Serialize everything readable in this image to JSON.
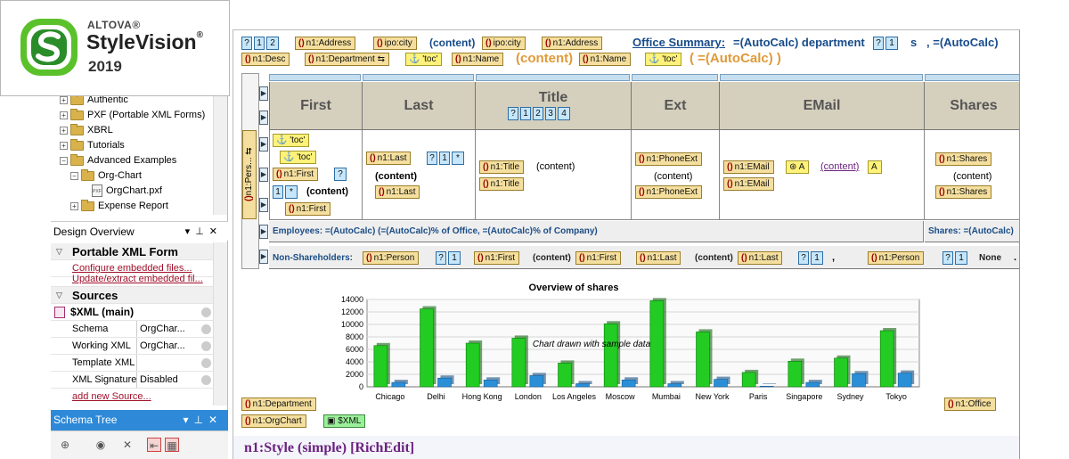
{
  "logo": {
    "brand": "ALTOVA®",
    "product": "StyleVision",
    "registered": "®",
    "year": "2019"
  },
  "tree": {
    "items": [
      {
        "label": "Authentic",
        "expanded": false
      },
      {
        "label": "PXF (Portable XML Forms)",
        "expanded": false
      },
      {
        "label": "XBRL",
        "expanded": false
      },
      {
        "label": "Tutorials",
        "expanded": false
      },
      {
        "label": "Advanced Examples",
        "expanded": true
      },
      {
        "label": "Org-Chart",
        "expanded": true
      },
      {
        "label": "OrgChart.pxf",
        "file": true
      },
      {
        "label": "Expense Report",
        "expanded": false
      }
    ]
  },
  "design_overview": {
    "title": "Design Overview",
    "pxf_header": "Portable XML Form",
    "pxf_links": [
      "Configure embedded files...",
      "Update/extract embedded fil..."
    ],
    "sources_header": "Sources",
    "xml_main": "$XML (main)",
    "props": [
      {
        "name": "Schema",
        "value": "OrgChar..."
      },
      {
        "name": "Working XML",
        "value": "OrgChar..."
      },
      {
        "name": "Template XML",
        "value": ""
      },
      {
        "name": "XML Signature",
        "value": "Disabled"
      }
    ],
    "add_source": "add new Source..."
  },
  "schema_tree": {
    "title": "Schema Tree"
  },
  "doc": {
    "line1": {
      "b1": "?",
      "b2": "1",
      "b3": "2",
      "t1": "n1:Address",
      "t2": "ipo:city",
      "content": "(content)",
      "t3": "ipo:city",
      "t4": "n1:Address",
      "office_summary": "Office Summary:",
      "calc1": "=(AutoCalc) department",
      "b4": "?",
      "b5": "1",
      "s": "s",
      "calc2": ", =(AutoCalc)"
    },
    "line2": {
      "t1": "n1:Desc",
      "t2": "n1:Department",
      "t3": "'toc'",
      "t4": "n1:Name",
      "content": "(content)",
      "t5": "n1:Name",
      "t6": "'toc'",
      "calc": "( =(AutoCalc) )"
    },
    "table": {
      "headers": [
        "First",
        "Last",
        "Title",
        "Ext",
        "EMail",
        "Shares"
      ],
      "title_btns": [
        "?",
        "1",
        "2",
        "3",
        "4"
      ],
      "side_tag": "n1:Pers...",
      "first": {
        "toc1": "'toc'",
        "toc2": "'toc'",
        "t1": "n1:First",
        "q": "?",
        "n1": "1",
        "star": "*",
        "content": "(content)",
        "t2": "n1:First"
      },
      "last": {
        "t1": "n1:Last",
        "q": "?",
        "n1": "1",
        "star": "*",
        "content": "(content)",
        "t2": "n1:Last"
      },
      "title": {
        "t1": "n1:Title",
        "content": "(content)",
        "t2": "n1:Title"
      },
      "ext": {
        "t1": "n1:PhoneExt",
        "content": "(content)",
        "t2": "n1:PhoneExt"
      },
      "email": {
        "t1": "n1:EMail",
        "a": "A",
        "content": "(content)",
        "a2": "A",
        "t2": "n1:EMail"
      },
      "shares": {
        "t1": "n1:Shares",
        "content": "(content)",
        "t2": "n1:Shares"
      },
      "employees": "Employees:  =(AutoCalc) (=(AutoCalc)% of Office, =(AutoCalc)% of Company)",
      "shares_footer": "Shares: =(AutoCalc)",
      "nonsh": {
        "label": "Non-Shareholders:",
        "t1": "n1:Person",
        "q": "?",
        "n1": "1",
        "t2": "n1:First",
        "content1": "(content)",
        "t3": "n1:First",
        "t4": "n1:Last",
        "content2": "(content)",
        "t5": "n1:Last",
        "q2": "?",
        "n2": "1",
        "comma": ",",
        "t6": "n1:Person",
        "q3": "?",
        "n3": "1",
        "none": "None",
        "dot": "."
      }
    },
    "bottom_tags": {
      "dept": "n1:Department",
      "org": "n1:OrgChart",
      "xml": "$XML",
      "office": "n1:Office"
    },
    "footer": "n1:Style (simple) [RichEdit]"
  },
  "chart_data": {
    "type": "bar",
    "title": "Overview of shares",
    "annotation": "Chart drawn with sample data",
    "categories": [
      "Chicago",
      "Delhi",
      "Hong Kong",
      "London",
      "Los Angeles",
      "Moscow",
      "Mumbai",
      "New York",
      "Paris",
      "Singapore",
      "Sydney",
      "Tokyo"
    ],
    "series": [
      {
        "values": [
          6600,
          12500,
          7000,
          7800,
          3800,
          10100,
          13800,
          8800,
          2300,
          4100,
          4600,
          9000
        ],
        "color": "#22cc22"
      },
      {
        "values": [
          700,
          1400,
          1100,
          1800,
          500,
          1100,
          500,
          1200,
          100,
          700,
          2100,
          2200
        ],
        "color": "#2a8fd6"
      }
    ],
    "ylim": [
      0,
      14000
    ],
    "yticks": [
      "0",
      "2000",
      "4000",
      "6000",
      "8000",
      "10000",
      "12000",
      "14000"
    ],
    "grid": true
  }
}
